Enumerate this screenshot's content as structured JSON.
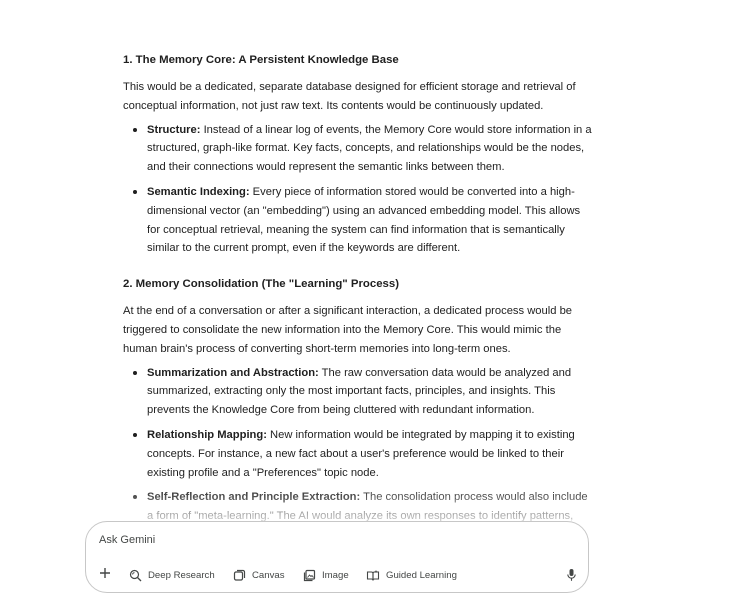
{
  "content": {
    "section1": {
      "heading": "1. The Memory Core: A Persistent Knowledge Base",
      "intro": "This would be a dedicated, separate database designed for efficient storage and retrieval of conceptual information, not just raw text. Its contents would be continuously updated.",
      "items": [
        {
          "term": "Structure:",
          "text": " Instead of a linear log of events, the Memory Core would store information in a structured, graph-like format. Key facts, concepts, and relationships would be the nodes, and their connections would represent the semantic links between them."
        },
        {
          "term": "Semantic Indexing:",
          "text": " Every piece of information stored would be converted into a high-dimensional vector (an \"embedding\") using an advanced embedding model. This allows for conceptual retrieval, meaning the system can find information that is semantically similar to the current prompt, even if the keywords are different."
        }
      ]
    },
    "section2": {
      "heading": "2. Memory Consolidation (The \"Learning\" Process)",
      "intro": "At the end of a conversation or after a significant interaction, a dedicated process would be triggered to consolidate the new information into the Memory Core. This would mimic the human brain's process of converting short-term memories into long-term ones.",
      "items": [
        {
          "term": "Summarization and Abstraction:",
          "text": " The raw conversation data would be analyzed and summarized, extracting only the most important facts, principles, and insights. This prevents the Knowledge Core from being cluttered with redundant information."
        },
        {
          "term": "Relationship Mapping:",
          "text": " New information would be integrated by mapping it to existing concepts. For instance, a new fact about a user's preference would be linked to their existing profile and a \"Preferences\" topic node."
        },
        {
          "term": "Self-Reflection and Principle Extraction:",
          "text": " The consolidation process would also include a form of \"meta-learning.\" The AI would analyze its own responses to identify patterns, errors,"
        }
      ]
    }
  },
  "input": {
    "placeholder": "Ask Gemini",
    "tools": [
      "Deep Research",
      "Canvas",
      "Image",
      "Guided Learning"
    ]
  },
  "icons": {
    "add": "plus-icon",
    "deep_research": "deep-research-icon",
    "canvas": "canvas-icon",
    "image": "image-icon",
    "guided_learning": "guided-learning-icon",
    "mic": "mic-icon"
  },
  "colors": {
    "text": "#1f1f1f",
    "muted": "#444746",
    "border": "#c7c7c7"
  }
}
